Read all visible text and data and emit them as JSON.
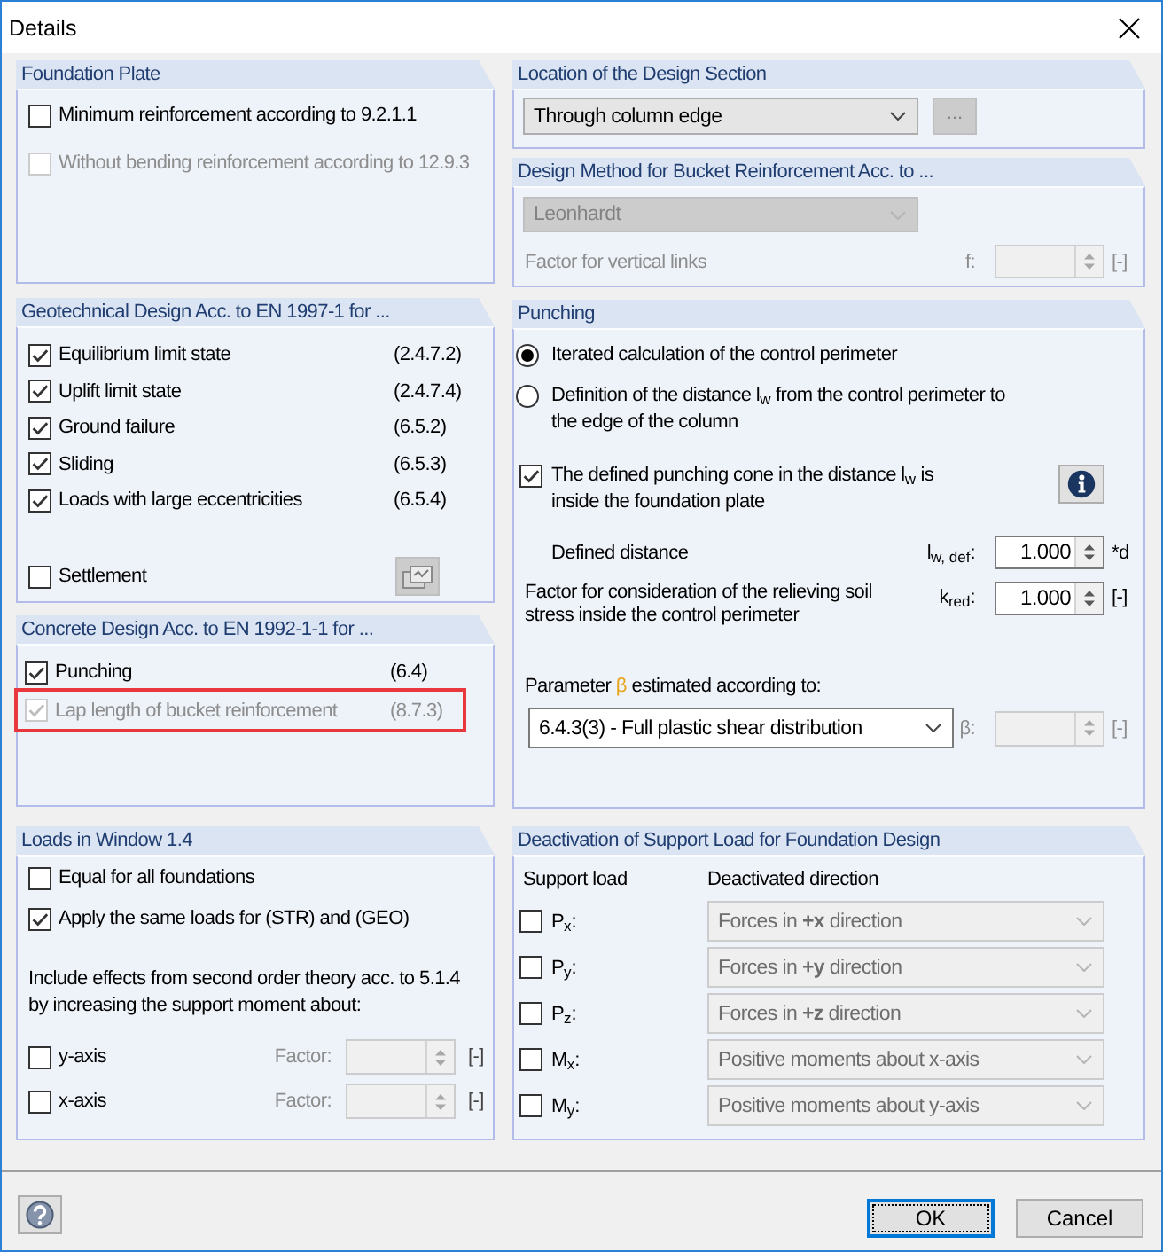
{
  "window": {
    "title": "Details"
  },
  "foundation_plate": {
    "title": "Foundation Plate",
    "options": [
      {
        "label": "Minimum reinforcement according to 9.2.1.1",
        "checked": false,
        "disabled": false
      },
      {
        "label": "Without bending reinforcement according to 12.9.3",
        "checked": false,
        "disabled": true
      }
    ]
  },
  "geotechnical_design": {
    "title": "Geotechnical Design Acc. to EN 1997-1 for ...",
    "options": [
      {
        "label": "Equilibrium limit state",
        "reference": "(2.4.7.2)",
        "checked": true
      },
      {
        "label": "Uplift limit state",
        "reference": "(2.4.7.4)",
        "checked": true
      },
      {
        "label": "Ground failure",
        "reference": "(6.5.2)",
        "checked": true
      },
      {
        "label": "Sliding",
        "reference": "(6.5.3)",
        "checked": true
      },
      {
        "label": "Loads with large eccentricities",
        "reference": "(6.5.4)",
        "checked": true
      }
    ],
    "settlement": {
      "label": "Settlement",
      "checked": false,
      "button": {
        "disabled": true
      }
    }
  },
  "concrete_design": {
    "title": "Concrete Design Acc. to EN 1992-1-1 for ...",
    "options": [
      {
        "label": "Punching",
        "reference": "(6.4)",
        "checked": true,
        "disabled": false,
        "highlighted": false
      },
      {
        "label": "Lap length of bucket reinforcement",
        "reference": "(8.7.3)",
        "checked": true,
        "disabled": true,
        "highlighted": true
      }
    ]
  },
  "loads_in_window": {
    "title": "Loads in Window 1.4",
    "options": [
      {
        "label": "Equal for all foundations",
        "checked": false
      },
      {
        "label": "Apply the same loads for (STR) and (GEO)",
        "checked": true
      }
    ],
    "note": "Include effects from second order theory acc. to 5.1.4 by increasing the support moment about:",
    "axes": [
      {
        "label": "y-axis",
        "checked": false,
        "factor_label": "Factor:",
        "unit": "[-]",
        "disabled": true
      },
      {
        "label": "x-axis",
        "checked": false,
        "factor_label": "Factor:",
        "unit": "[-]",
        "disabled": true
      }
    ]
  },
  "location_of_design_section": {
    "title": "Location of the Design Section",
    "dropdown": {
      "value": "Through column edge"
    },
    "more_button": {
      "label": "...",
      "disabled": true
    }
  },
  "design_method": {
    "title": "Design Method for Bucket Reinforcement Acc. to ...",
    "dropdown": {
      "value": "Leonhardt",
      "disabled": true
    },
    "factor": {
      "label": "Factor for vertical links",
      "symbol": "f:",
      "unit": "[-]",
      "disabled": true
    }
  },
  "punching": {
    "title": "Punching",
    "methods": [
      {
        "label": "Iterated calculation of the control perimeter",
        "selected": true
      },
      {
        "label": "Definition of the distance l$_{w}$ from the control perimeter to the edge of the column",
        "selected": false
      }
    ],
    "cone_check": {
      "label": "The defined punching cone in the distance l$_{w}$ is inside the foundation plate",
      "checked": true
    },
    "values": [
      {
        "label": "Defined distance",
        "symbol": "l$_{w, def}$:",
        "value": "1.000",
        "unit": "*d"
      },
      {
        "label": "Factor for consideration of the relieving soil stress inside the control perimeter",
        "symbol": "k$_{red}$:",
        "value": "1.000",
        "unit": "[-]"
      }
    ],
    "beta": {
      "label_start": "Parameter",
      "symbol": "β",
      "label_end": "estimated according to:",
      "dropdown": {
        "value": "6.4.3(3) - Full plastic shear distribution"
      },
      "field_symbol": "β:",
      "unit": "[-]",
      "disabled": true
    }
  },
  "deactivation": {
    "title": "Deactivation of Support Load for Foundation Design",
    "headers": [
      "Support load",
      "Deactivated direction"
    ],
    "rows": [
      {
        "label": "P$_{x}$:",
        "checked": false,
        "direction": "Forces in **+x** direction",
        "disabled": true
      },
      {
        "label": "P$_{y}$:",
        "checked": false,
        "direction": "Forces in **+y** direction",
        "disabled": true
      },
      {
        "label": "P$_{z}$:",
        "checked": false,
        "direction": "Forces in **+z** direction",
        "disabled": true
      },
      {
        "label": "M$_{x}$:",
        "checked": false,
        "direction": "Positive moments about x-axis",
        "disabled": true
      },
      {
        "label": "M$_{y}$:",
        "checked": false,
        "direction": "Positive moments about y-axis",
        "disabled": true
      }
    ]
  },
  "footer": {
    "buttons": [
      {
        "label": "OK",
        "default": true
      },
      {
        "label": "Cancel",
        "default": false
      }
    ]
  }
}
